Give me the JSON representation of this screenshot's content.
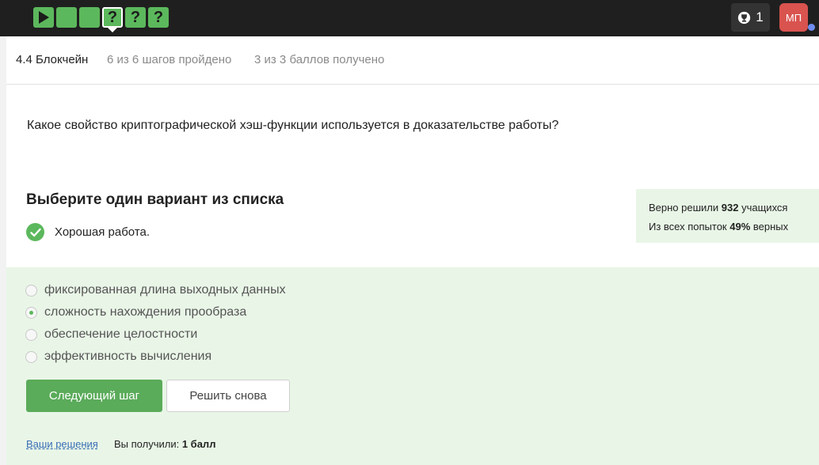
{
  "steps": [
    {
      "state": "start",
      "symbol": ""
    },
    {
      "state": "done",
      "symbol": ""
    },
    {
      "state": "done",
      "symbol": ""
    },
    {
      "state": "current",
      "symbol": "?"
    },
    {
      "state": "quiz",
      "symbol": "?"
    },
    {
      "state": "quiz",
      "symbol": "?"
    }
  ],
  "header": {
    "trophy_count": "1",
    "avatar_initials": "МП"
  },
  "lesson": {
    "title": "4.4 Блокчейн",
    "steps_progress": "6 из 6 шагов пройдено",
    "score_progress": "3 из 3 баллов  получено"
  },
  "question": "Какое свойство криптографической хэш-функции используется в доказательстве работы?",
  "choose_title": "Выберите один вариант из списка",
  "feedback": "Хорошая работа.",
  "stats": {
    "solved_prefix": "Верно решили",
    "solved_count": "932",
    "solved_suffix": "учащихся",
    "attempts_prefix": "Из всех попыток",
    "attempts_percent": "49%",
    "attempts_suffix": "верных"
  },
  "options": [
    {
      "label": "фиксированная длина выходных данных",
      "selected": false
    },
    {
      "label": "сложность нахождения прообраза",
      "selected": true
    },
    {
      "label": "обеспечение целостности",
      "selected": false
    },
    {
      "label": "эффективность вычисления",
      "selected": false
    }
  ],
  "buttons": {
    "next": "Следующий шаг",
    "retry": "Решить снова"
  },
  "footer": {
    "solutions_link": "Ваши решения",
    "result_prefix": "Вы получили:",
    "result_value": "1 балл"
  },
  "colors": {
    "accent_green": "#5cb85c",
    "topbar": "#1f1f1f",
    "answer_bg": "#e9f6e7",
    "avatar": "#d9534f"
  }
}
